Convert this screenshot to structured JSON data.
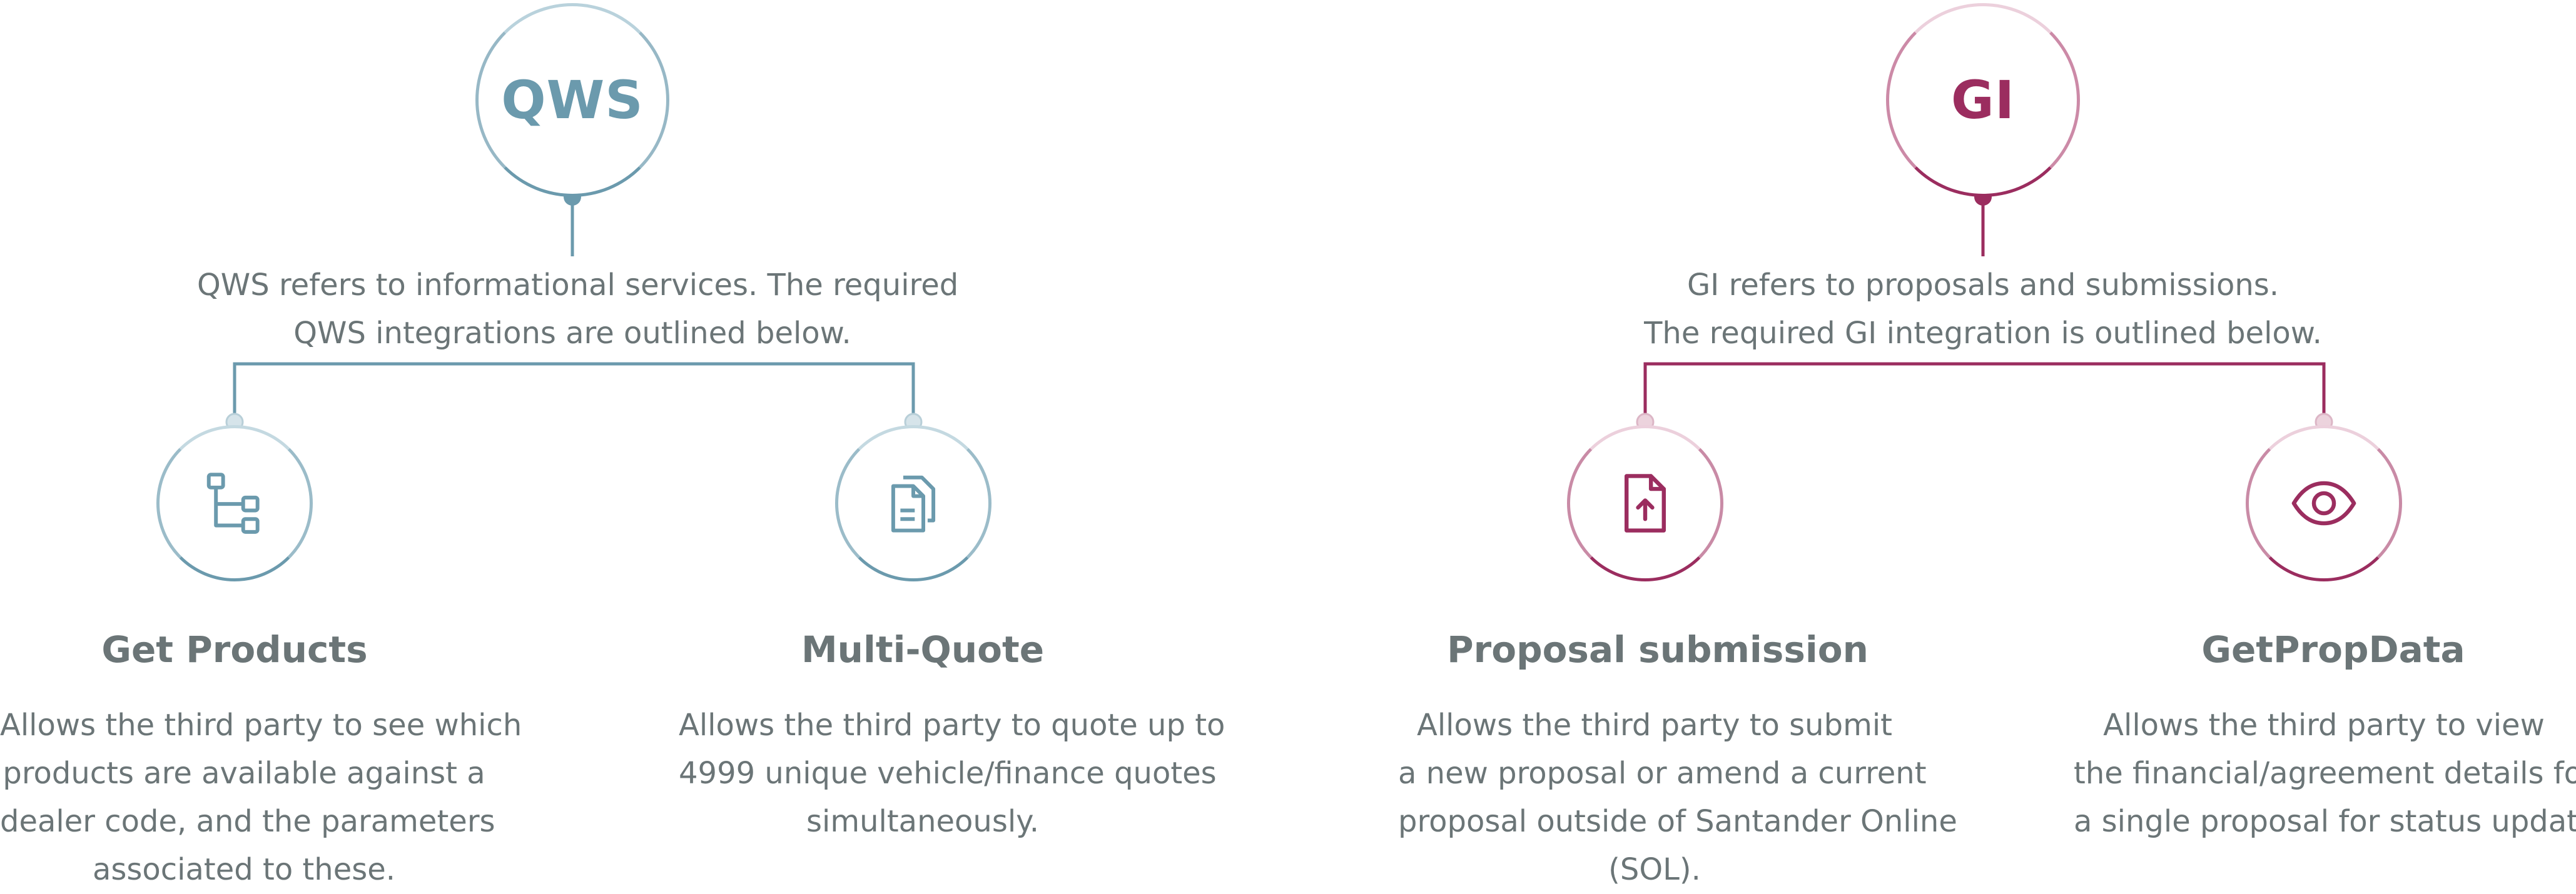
{
  "colors": {
    "qws_accent": "#6b9aad",
    "qws_light": "#d6e4ea",
    "gi_accent": "#9b2d5f",
    "gi_light": "#ecd3dd",
    "text": "#6b7577"
  },
  "qws": {
    "acronym": "QWS",
    "description": [
      "QWS refers to informational services. The required",
      "QWS integrations are outlined below."
    ],
    "items": [
      {
        "icon": "hierarchy-icon",
        "title": "Get Products",
        "description": [
          "Allows the third party to see which",
          "products are available against a",
          "dealer code, and the parameters",
          "associated to these."
        ]
      },
      {
        "icon": "documents-icon",
        "title": "Multi-Quote",
        "description": [
          "Allows the third party to quote up to",
          "4999 unique vehicle/finance quotes",
          "simultaneously."
        ]
      }
    ]
  },
  "gi": {
    "acronym": "GI",
    "description": [
      "GI refers to proposals and submissions.",
      "The required GI integration is outlined below."
    ],
    "items": [
      {
        "icon": "file-upload-icon",
        "title": "Proposal submission",
        "description": [
          "Allows the third party to submit",
          "a new proposal or amend a current",
          "proposal outside of Santander Online",
          "(SOL)."
        ]
      },
      {
        "icon": "eye-icon",
        "title": "GetPropData",
        "description": [
          "Allows the third party to view",
          "the financial/agreement details for",
          "a single proposal for status updates"
        ]
      }
    ]
  }
}
